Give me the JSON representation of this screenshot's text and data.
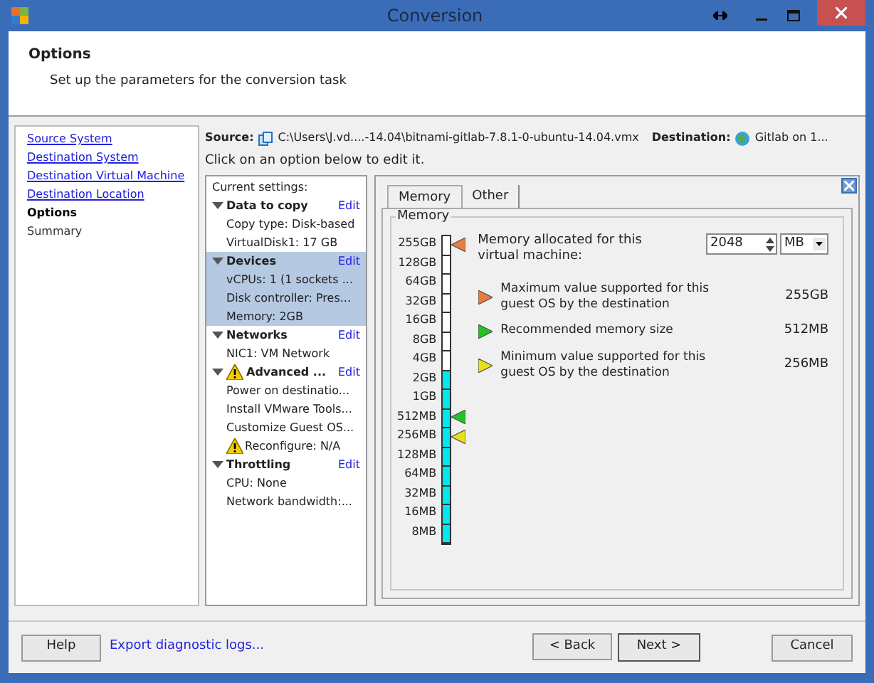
{
  "window": {
    "title": "Conversion"
  },
  "header": {
    "title": "Options",
    "subtitle": "Set up the parameters for the conversion task"
  },
  "nav": [
    {
      "label": "Source System",
      "kind": "link"
    },
    {
      "label": "Destination System",
      "kind": "link"
    },
    {
      "label": "Destination Virtual Machine",
      "kind": "link"
    },
    {
      "label": "Destination Location",
      "kind": "link"
    },
    {
      "label": "Options",
      "kind": "current"
    },
    {
      "label": "Summary",
      "kind": "plain"
    }
  ],
  "source": {
    "label": "Source:",
    "path": "C:\\Users\\J.vd....-14.04\\bitnami-gitlab-7.8.1-0-ubuntu-14.04.vmx",
    "dest_label": "Destination:",
    "dest": "Gitlab on 1..."
  },
  "hint": "Click on an option below to edit it.",
  "settings": {
    "title": "Current settings:",
    "groups": [
      {
        "name": "Data to copy",
        "edit": "Edit",
        "selected": false,
        "warning": false,
        "items": [
          {
            "text": "Copy type: Disk-based",
            "warning": false
          },
          {
            "text": "VirtualDisk1: 17 GB",
            "warning": false
          }
        ]
      },
      {
        "name": "Devices",
        "edit": "Edit",
        "selected": true,
        "warning": false,
        "items": [
          {
            "text": "vCPUs: 1 (1 sockets ...",
            "warning": false
          },
          {
            "text": "Disk controller: Pres...",
            "warning": false
          },
          {
            "text": "Memory: 2GB",
            "warning": false
          }
        ]
      },
      {
        "name": "Networks",
        "edit": "Edit",
        "selected": false,
        "warning": false,
        "items": [
          {
            "text": "NIC1: VM Network",
            "warning": false
          }
        ]
      },
      {
        "name": "Advanced ...",
        "edit": "Edit",
        "selected": false,
        "warning": true,
        "items": [
          {
            "text": "Power on destinatio...",
            "warning": false
          },
          {
            "text": "Install VMware Tools...",
            "warning": false
          },
          {
            "text": "Customize Guest OS...",
            "warning": false
          },
          {
            "text": "Reconfigure: N/A",
            "warning": true
          }
        ]
      },
      {
        "name": "Throttling",
        "edit": "Edit",
        "selected": false,
        "warning": false,
        "items": [
          {
            "text": "CPU: None",
            "warning": false
          },
          {
            "text": "Network bandwidth:...",
            "warning": false
          }
        ]
      }
    ]
  },
  "tabs": [
    {
      "label": "Memory",
      "selected": true
    },
    {
      "label": "Other",
      "selected": false
    }
  ],
  "memory": {
    "group": "Memory",
    "level": 0.5625,
    "scale": [
      {
        "label": "255GB",
        "color": "#e87d3e"
      },
      {
        "label": "128GB"
      },
      {
        "label": "64GB"
      },
      {
        "label": "32GB"
      },
      {
        "label": "16GB"
      },
      {
        "label": "8GB"
      },
      {
        "label": "4GB"
      },
      {
        "label": "2GB"
      },
      {
        "label": "1GB"
      },
      {
        "label": "512MB",
        "color": "#22c322"
      },
      {
        "label": "256MB",
        "color": "#e8e01a"
      },
      {
        "label": "128MB"
      },
      {
        "label": "64MB"
      },
      {
        "label": "32MB"
      },
      {
        "label": "16MB"
      },
      {
        "label": "8MB"
      }
    ],
    "alloc_label": "Memory allocated for this virtual machine:",
    "value": "2048",
    "unit": "MB",
    "legend": [
      {
        "text": "Maximum value supported for this guest OS by the destination",
        "value": "255GB",
        "color": "#e87d3e"
      },
      {
        "text": "Recommended memory size",
        "value": "512MB",
        "color": "#22c322"
      },
      {
        "text": "Minimum value supported for this guest OS by the destination",
        "value": "256MB",
        "color": "#e8e01a"
      }
    ]
  },
  "buttons": {
    "help": "Help",
    "export": "Export diagnostic logs...",
    "back": "< Back",
    "next": "Next >",
    "cancel": "Cancel"
  }
}
